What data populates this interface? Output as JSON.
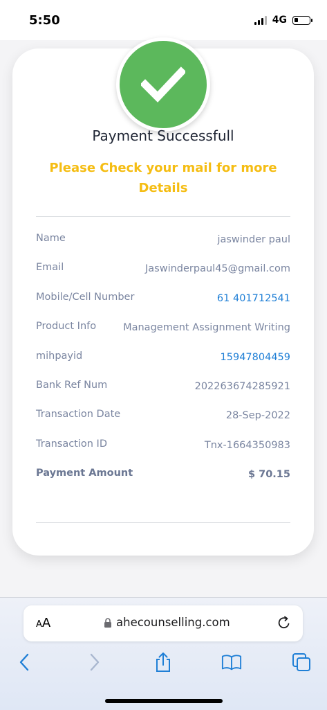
{
  "status_bar": {
    "time": "5:50",
    "network": "4G",
    "battery_level": 0.25
  },
  "card": {
    "title": "Payment Successfull",
    "message": "Please Check your mail for more Details",
    "status_icon": "checkmark-icon",
    "accent_color": "#5cb85c",
    "message_color": "#f5bd13",
    "details": [
      {
        "label": "Name",
        "value": "jaswinder paul"
      },
      {
        "label": "Email",
        "value": "Jaswinderpaul45@gmail.com"
      },
      {
        "label": "Mobile/Cell Number",
        "value": "61 401712541"
      },
      {
        "label": "Product Info",
        "value": "Management Assignment Writing"
      },
      {
        "label": "mihpayid",
        "value": "15947804459"
      },
      {
        "label": "Bank Ref Num",
        "value": "202263674285921"
      },
      {
        "label": "Transaction Date",
        "value": "28-Sep-2022"
      },
      {
        "label": "Transaction ID",
        "value": "Tnx-1664350983"
      },
      {
        "label": "Payment Amount",
        "value": "$ 70.15"
      }
    ]
  },
  "browser": {
    "aa_small": "A",
    "aa_large": "A",
    "url": "ahecounselling.com",
    "link_color": "#1f7fd6",
    "toolbar_icons": [
      "back-icon",
      "forward-icon",
      "share-icon",
      "bookmarks-icon",
      "tabs-icon"
    ]
  }
}
